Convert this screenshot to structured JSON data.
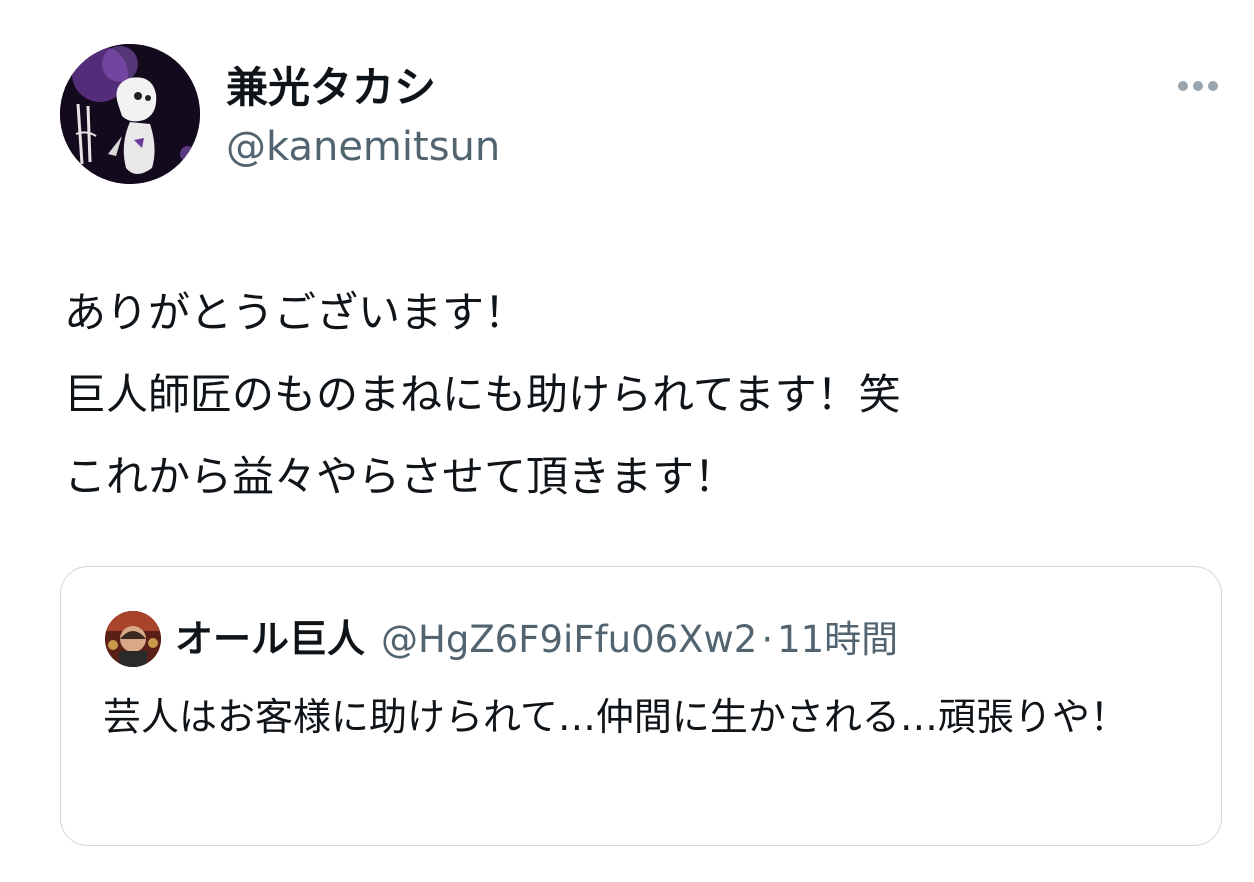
{
  "tweet": {
    "author": {
      "display_name": "兼光タカシ",
      "handle": "@kanemitsun",
      "avatar_icon": "profile-avatar"
    },
    "more_icon": "more-horizontal-icon",
    "text": "ありがとうございます！\n巨人師匠のものまねにも助けられてます！笑\nこれから益々やらさせて頂きます！"
  },
  "quoted_tweet": {
    "author": {
      "display_name": "オール巨人",
      "handle": "@HgZ6F9iFfu06Xw2",
      "avatar_icon": "profile-avatar"
    },
    "separator": "·",
    "time": "11時間",
    "text": "芸人はお客様に助けられて…仲間に生かされる…頑張りや！"
  },
  "colors": {
    "text_primary": "#0f1419",
    "text_secondary": "#536471",
    "border": "#cfd9de",
    "background": "#ffffff"
  }
}
